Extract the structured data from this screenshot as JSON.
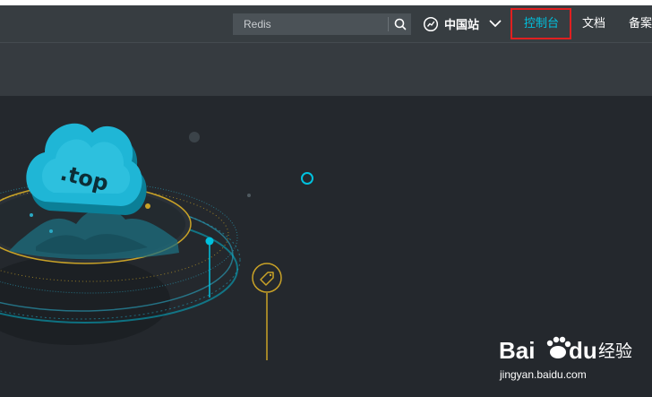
{
  "search": {
    "value": "Redis"
  },
  "icons": {
    "search": "search-icon",
    "region": "globe-icon",
    "chevron": "chevron-down-icon",
    "tag": "tag-icon"
  },
  "nav": {
    "region_label": "中国站",
    "console_label": "控制台",
    "docs_label": "文档",
    "beian_label": "备案"
  },
  "hero": {
    "domain_suffix": ".top"
  },
  "watermark": {
    "site": "jingyan.baidu.com"
  },
  "colors": {
    "accent": "#00c1de",
    "highlight_box": "#e02020",
    "navbar_bg": "#373d41",
    "subbar_bg": "#363b40",
    "hero_bg": "#24282d",
    "gold": "#c9a227"
  }
}
